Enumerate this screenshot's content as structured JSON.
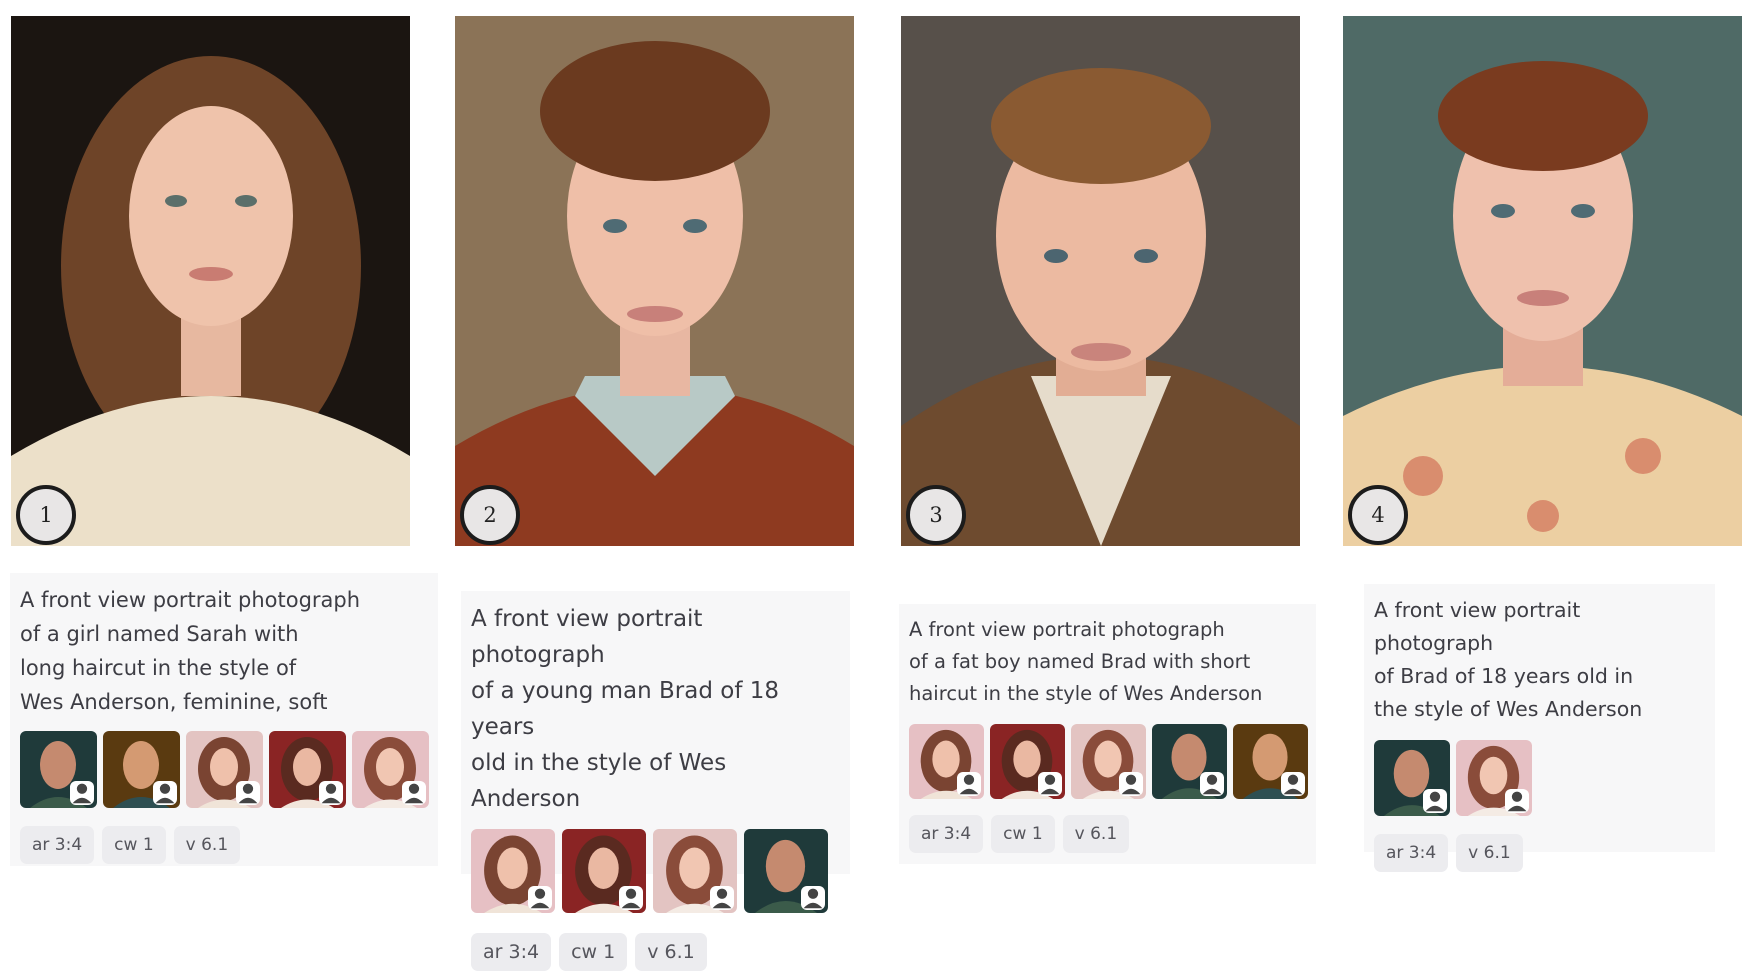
{
  "items": [
    {
      "number": "1",
      "prompt_lines": [
        "A front view portrait photograph",
        "of a girl named Sarah with",
        "long haircut in the style of",
        "Wes Anderson, feminine, soft"
      ],
      "references": [
        "man-portrait-icon",
        "man-portrait-icon",
        "woman-portrait-icon",
        "woman-portrait-icon",
        "woman-portrait-icon"
      ],
      "params": [
        "ar 3:4",
        "cw 1",
        "v 6.1"
      ]
    },
    {
      "number": "2",
      "prompt_lines": [
        "A front view portrait photograph",
        "of a young man Brad of 18 years",
        "old in the style of Wes Anderson"
      ],
      "references": [
        "woman-portrait-icon",
        "woman-portrait-icon",
        "woman-portrait-icon",
        "man-portrait-icon"
      ],
      "params": [
        "ar 3:4",
        "cw 1",
        "v 6.1"
      ]
    },
    {
      "number": "3",
      "prompt_lines": [
        "A front view portrait photograph",
        "of a fat boy named Brad with short",
        "haircut in the style of Wes Anderson"
      ],
      "references": [
        "woman-portrait-icon",
        "woman-portrait-icon",
        "woman-portrait-icon",
        "man-portrait-icon",
        "man-portrait-icon"
      ],
      "params": [
        "ar 3:4",
        "cw 1",
        "v 6.1"
      ]
    },
    {
      "number": "4",
      "prompt_lines": [
        "A front view portrait photograph",
        "of Brad of 18 years old in",
        "the style of Wes Anderson"
      ],
      "references": [
        "man-portrait-icon",
        "woman-portrait-icon"
      ],
      "params": [
        "ar 3:4",
        "v 6.1"
      ]
    }
  ],
  "icons": {
    "reference_badge": "person-icon"
  },
  "colors": {
    "card_bg": "#f7f7f8",
    "chip_bg": "#ececef",
    "chip_text": "#55555c",
    "badge_border": "#1c1c1c"
  }
}
